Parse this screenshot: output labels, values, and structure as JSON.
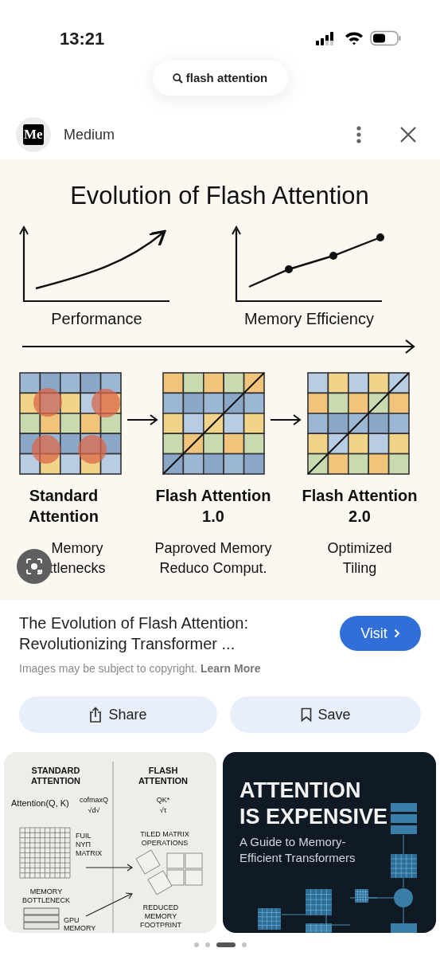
{
  "status_bar": {
    "time": "13:21"
  },
  "search": {
    "query": "flash attention"
  },
  "source": {
    "logo": "Me",
    "name": "Medium"
  },
  "image": {
    "title": "Evolution of Flash Attention",
    "charts": [
      {
        "kind": "curve",
        "label": "Performance"
      },
      {
        "kind": "points",
        "label": "Memory Efficiency"
      }
    ],
    "stages": [
      {
        "kind": "standard",
        "name": [
          "Standard",
          "Attention"
        ],
        "note": [
          "Memory",
          "ttlenecks"
        ]
      },
      {
        "kind": "flash",
        "name": [
          "Flash Attention",
          "1.0"
        ],
        "note": [
          "Paproved Memory",
          "Reduco Comput."
        ]
      },
      {
        "kind": "flash",
        "name": [
          "Flash Attention",
          "2.0"
        ],
        "note": [
          "Optimized",
          "Tiling"
        ]
      }
    ]
  },
  "result": {
    "title": "The Evolution of Flash Attention: Revolutionizing Transformer ...",
    "visit": "Visit",
    "notice": "Images may be subject to copyright.",
    "learn_more": "Learn More"
  },
  "actions": [
    {
      "kind": "share",
      "label": "Share"
    },
    {
      "kind": "save",
      "label": "Save"
    }
  ],
  "related": [
    {
      "kind": "diagram",
      "left_heading": [
        "STANDARD",
        "ATTENTION"
      ],
      "right_heading": [
        "FLASH",
        "ATTENTION"
      ],
      "formula": "Attention(Q, K)",
      "formula_top": "cofmaxQ",
      "formula_bottom": "√d√",
      "flash_top": "QK*",
      "flash_bottom": "√τ",
      "matrix_label": [
        "FUIL",
        "NYΠ",
        "MATRIX"
      ],
      "tiled_label": [
        "TILED MATRIX",
        "OPERATIONS"
      ],
      "bottleneck_label": [
        "MEMORY",
        "BOTTLENECK"
      ],
      "reduced_label": [
        "REDUCED",
        "MEMORY",
        "FOOTPRINT"
      ],
      "gpu_label": [
        "GPU",
        "MEMORY"
      ]
    },
    {
      "kind": "cover",
      "title": [
        "ATTENTION",
        "IS EXPENSIVE"
      ],
      "subtitle": [
        "A Guide to Memory-",
        "Efficient Transformers"
      ]
    }
  ],
  "pager": [
    {
      "selected": false
    },
    {
      "selected": false
    },
    {
      "selected": true
    },
    {
      "selected": false
    }
  ]
}
